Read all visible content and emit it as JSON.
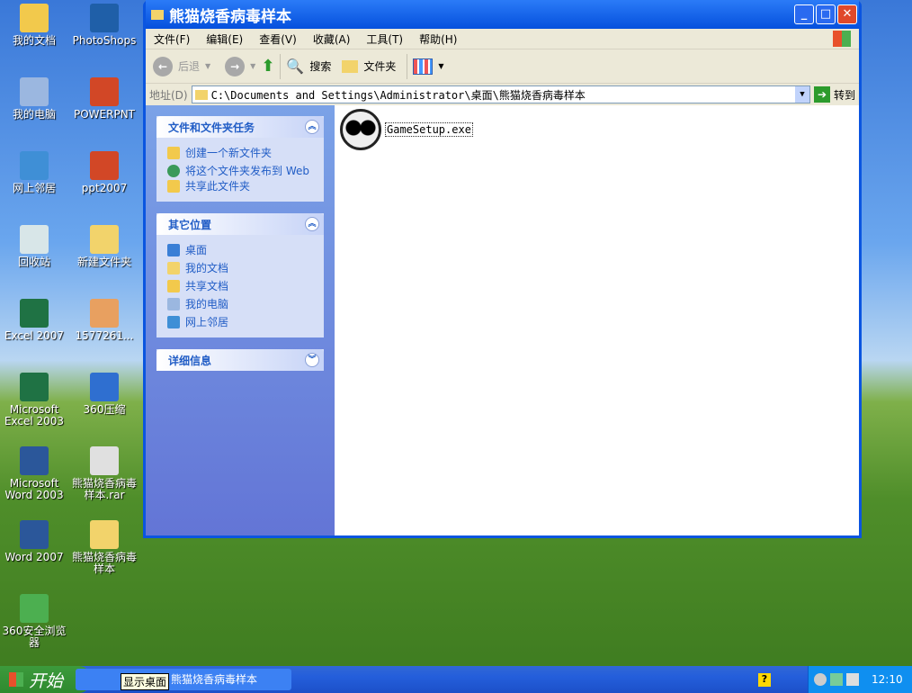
{
  "desktop": {
    "icons": [
      {
        "label": "我的文档",
        "color": "#f2c94c"
      },
      {
        "label": "PhotoShops",
        "color": "#1f5fa8"
      },
      {
        "label": "我的电脑",
        "color": "#9bb7e0"
      },
      {
        "label": "POWERPNT",
        "color": "#d24726"
      },
      {
        "label": "网上邻居",
        "color": "#3f8fd6"
      },
      {
        "label": "ppt2007",
        "color": "#d24726"
      },
      {
        "label": "回收站",
        "color": "#d8e6e8"
      },
      {
        "label": "新建文件夹",
        "color": "#f2d36b"
      },
      {
        "label": "Excel 2007",
        "color": "#1f7244"
      },
      {
        "label": "1577261...",
        "color": "#e8a060"
      },
      {
        "label": "Microsoft Excel 2003",
        "color": "#1f7244"
      },
      {
        "label": "360压缩",
        "color": "#2f6fd0"
      },
      {
        "label": "Microsoft Word 2003",
        "color": "#2b579a"
      },
      {
        "label": "熊猫烧香病毒样本.rar",
        "color": "#e0e0e0"
      },
      {
        "label": "Word 2007",
        "color": "#2b579a"
      },
      {
        "label": "熊猫烧香病毒样本",
        "color": "#f2d36b"
      },
      {
        "label": "360安全浏览器",
        "color": "#4caf50"
      }
    ]
  },
  "window": {
    "title": "熊猫烧香病毒样本",
    "menu": [
      "文件(F)",
      "编辑(E)",
      "查看(V)",
      "收藏(A)",
      "工具(T)",
      "帮助(H)"
    ],
    "toolbar": {
      "back": "后退",
      "search": "搜索",
      "folders": "文件夹"
    },
    "address": {
      "label": "地址(D)",
      "value": "C:\\Documents and Settings\\Administrator\\桌面\\熊猫烧香病毒样本",
      "go": "转到"
    },
    "panels": [
      {
        "title": "文件和文件夹任务",
        "items": [
          "创建一个新文件夹",
          "将这个文件夹发布到 Web",
          "共享此文件夹"
        ]
      },
      {
        "title": "其它位置",
        "items": [
          "桌面",
          "我的文档",
          "共享文档",
          "我的电脑",
          "网上邻居"
        ]
      },
      {
        "title": "详细信息",
        "items": []
      }
    ],
    "files": [
      {
        "name": "GameSetup.exe"
      }
    ]
  },
  "taskbar": {
    "start": "开始",
    "tooltip": "显示桌面",
    "task": "熊猫烧香病毒样本",
    "clock": "12:10"
  }
}
